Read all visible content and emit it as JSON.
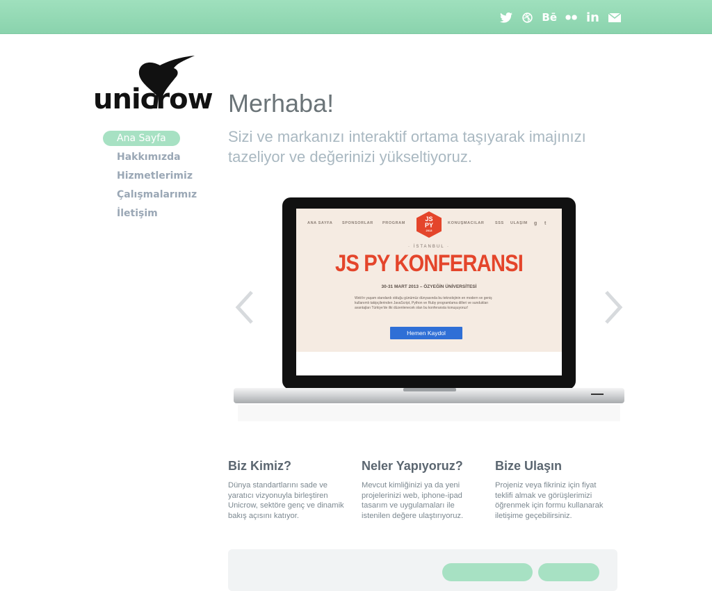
{
  "social": {
    "twitter": "twitter-icon",
    "dribbble": "dribbble-icon",
    "behance_label": "Bē",
    "flickr": "flickr-icon",
    "linkedin_label": "in",
    "mail": "mail-icon"
  },
  "brand": {
    "logo_text": "unicrow"
  },
  "nav": {
    "items": [
      {
        "label": "Ana Sayfa"
      },
      {
        "label": "Hakkımızda"
      },
      {
        "label": "Hizmetlerimiz"
      },
      {
        "label": "Çalışmalarımız"
      },
      {
        "label": "İletişim"
      }
    ]
  },
  "hero": {
    "title": "Merhaba!",
    "subtitle": "Sizi ve markanızı interaktif ortama taşıyarak imajınızı tazeliyor ve değerinizi yükseltiyoruz."
  },
  "slide": {
    "nav": [
      "ANA SAYFA",
      "SPONSORLAR",
      "PROGRAM",
      "KONUŞMACILAR",
      "SSS",
      "ULAŞIM"
    ],
    "badge_line1": "JS",
    "badge_line2": "PY",
    "badge_year": "2013",
    "city": "· İSTANBUL ·",
    "headline": "JS PY KONFERANSI",
    "date": "30-31 MART 2013 – ÖZYEĞİN ÜNİVERSİTESİ",
    "desc": "Web'in yaşam standardı olduğu günümüz dünyasında bu teknolojinin en modern ve geniş kullanımlı takipçilerinden JavaScript, Python ve Ruby programlama dilleri ve sundukları avantajları Türkiye'de ilki düzenlenecek olan bu konferansta konuşuyoruz!",
    "cta": "Hemen Kaydol"
  },
  "columns": [
    {
      "title": "Biz Kimiz?",
      "text": "Dünya standartlarını sade ve yaratıcı vizyonuyla birleştiren Unicrow, sektöre genç ve dinamik bakış açısını katıyor."
    },
    {
      "title": "Neler Yapıyoruz?",
      "text": "Mevcut kimliğinizi ya da yeni projelerinizi web, iphone-ipad tasarım ve uygulamaları ile istenilen değere ulaştırıyoruz."
    },
    {
      "title": "Bize Ulaşın",
      "text": "Projeniz veya fikriniz için fiyat teklifi almak ve görüşlerimizi öğrenmek için formu kullanarak iletişime geçebilirsiniz."
    }
  ],
  "colors": {
    "accent": "#a7e1c3",
    "topbar": "#94d9b5",
    "cta_blue": "#2f6fd6",
    "badge_red": "#e4452b"
  }
}
